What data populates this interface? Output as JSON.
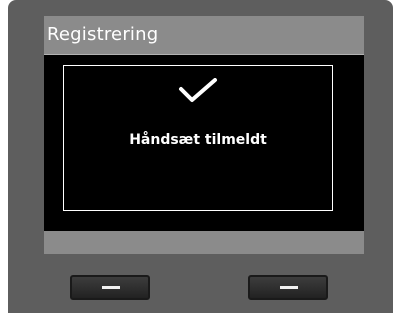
{
  "header": {
    "title": "Registrering"
  },
  "dialog": {
    "icon": "checkmark-icon",
    "message": "Håndsæt tilmeldt"
  },
  "softkeys": {
    "left": {
      "icon": "dash-icon"
    },
    "right": {
      "icon": "dash-icon"
    }
  },
  "colors": {
    "bezel": "#5e5e5e",
    "screen_gray": "#8b8b8b",
    "content_bg": "#000000",
    "text": "#ffffff"
  }
}
